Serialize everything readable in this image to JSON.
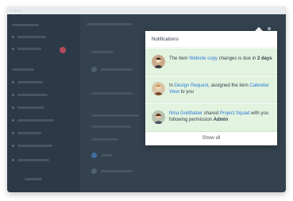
{
  "app": {
    "window_controls": [
      "close-dot",
      "minimize-dot",
      "maximize-dot"
    ],
    "accent_color": "#2b7ad6",
    "highlight_bg": "#e2f3e0"
  },
  "notifications": {
    "title": "Notifications",
    "items": [
      {
        "prefix": "The item ",
        "link1": "Website copy",
        "middle": " changes is due in ",
        "link2": "",
        "suffix": "",
        "bold": "2 days"
      },
      {
        "prefix": "In ",
        "link1": "Design Request",
        "middle": ", assigned the item ",
        "link2": "Calendar View",
        "suffix": " to you",
        "bold": ""
      },
      {
        "prefix": "",
        "link1": "Nina Goldhaber",
        "middle": " shared ",
        "link2": "Project Squad",
        "suffix": " with you following permission ",
        "bold": "Admin"
      }
    ],
    "show_all": "Show all"
  },
  "icons": {
    "bell": "bell-icon"
  }
}
